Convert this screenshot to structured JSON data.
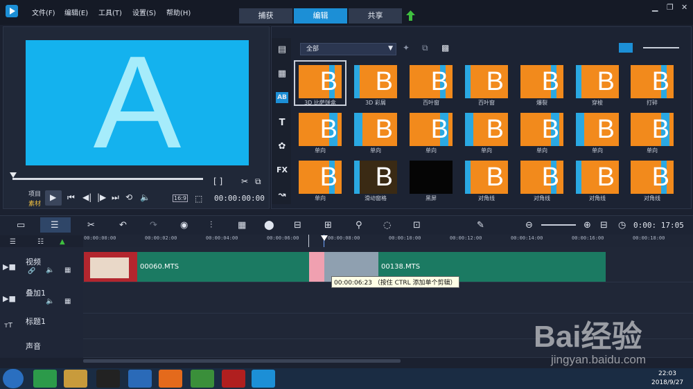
{
  "menu": {
    "file": "文件(F)",
    "edit": "编辑(E)",
    "tools": "工具(T)",
    "settings": "设置(S)",
    "help": "帮助(H)"
  },
  "tabs": [
    "捕获",
    "编辑",
    "共享"
  ],
  "preview": {
    "letter": "A",
    "project_label": "项目",
    "clip_label": "素材",
    "timecode": "00:00:00:00",
    "aspect": "16:9",
    "brackets": "[ ]"
  },
  "library": {
    "dropdown": "全部",
    "rows": [
      [
        "3D 比萨饼盒",
        "3D 彩屑",
        "百叶窗",
        "百叶窗",
        "爆裂",
        "穿梭",
        "打碎"
      ],
      [
        "单向",
        "单向",
        "单向",
        "单向",
        "单向",
        "单向",
        "单向"
      ],
      [
        "单向",
        "滑动窗格",
        "黑屏",
        "对角线",
        "对角线",
        "对角线",
        "对角线"
      ]
    ]
  },
  "timeline": {
    "timecode": "0:00: 17:05",
    "ruler": [
      "00:00:00:00",
      "00:00:02:00",
      "00:00:04:00",
      "00:00:06:00",
      "00:00:08:00",
      "00:00:10:00",
      "00:00:12:00",
      "00:00:14:00",
      "00:00:16:00",
      "00:00:18:00"
    ],
    "tracks": [
      "视频",
      "叠加1",
      "标题1",
      "声音"
    ],
    "clips": [
      "00060.MTS",
      "00138.MTS"
    ],
    "tooltip": "00:00:06:23 （按住 CTRL 添加单个剪辑）"
  },
  "taskbar": {
    "time": "22:03",
    "date": "2018/9/27"
  },
  "watermark": {
    "brand": "Bai经验",
    "url": "jingyan.baidu.com"
  },
  "colors": {
    "accent": "#1c8fd6",
    "clip": "#1b7a62",
    "transition": "#f28a1c"
  }
}
